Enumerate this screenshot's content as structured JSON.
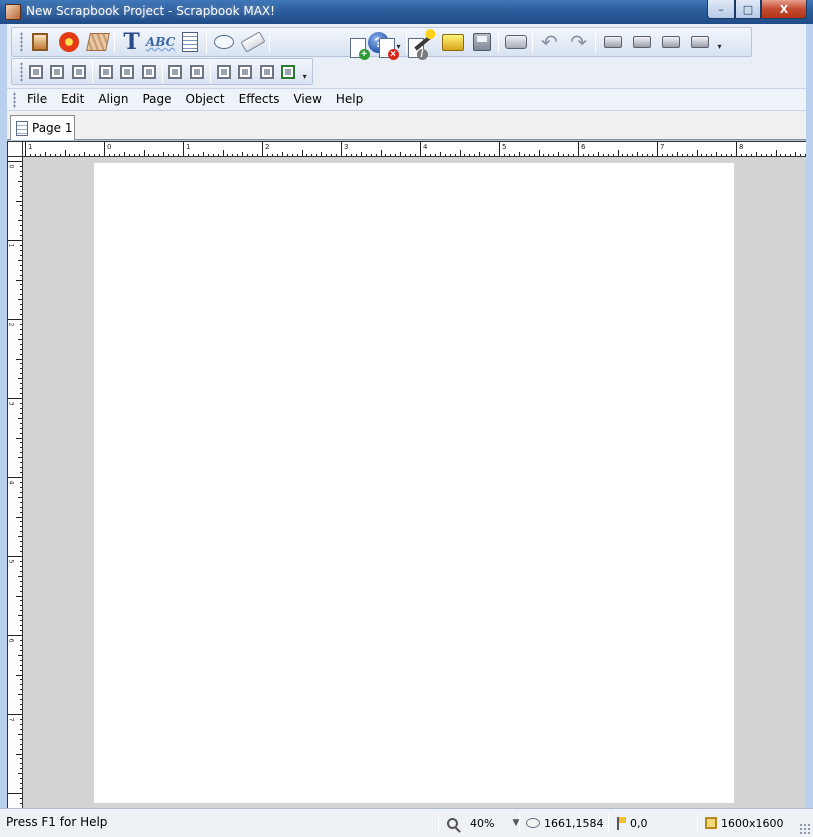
{
  "window": {
    "title": "New Scrapbook Project - Scrapbook MAX!",
    "buttons": {
      "minimize": "–",
      "maximize": "□",
      "close": "X"
    }
  },
  "toolbar1": {
    "buttons": [
      {
        "icon": "portrait-icon"
      },
      {
        "icon": "flower-icon"
      },
      {
        "icon": "paper-icon"
      },
      {
        "icon": "text-icon",
        "glyph": "T"
      },
      {
        "icon": "spellcheck-icon",
        "glyph": "ABC"
      },
      {
        "icon": "notepad-icon"
      },
      {
        "icon": "speech-balloon-icon"
      },
      {
        "icon": "eraser-icon"
      },
      {
        "icon": "new-page-icon"
      },
      {
        "icon": "delete-page-icon"
      },
      {
        "icon": "edit-page-icon"
      },
      {
        "icon": "help-icon",
        "glyph": "?"
      },
      {
        "icon": "magic-wand-icon"
      },
      {
        "icon": "open-folder-icon"
      },
      {
        "icon": "save-icon"
      },
      {
        "icon": "printer-icon"
      },
      {
        "icon": "undo-icon",
        "glyph": "↶"
      },
      {
        "icon": "redo-icon",
        "glyph": "↷"
      },
      {
        "icon": "bring-to-front-icon"
      },
      {
        "icon": "bring-forward-icon"
      },
      {
        "icon": "send-backward-icon"
      },
      {
        "icon": "send-to-back-icon"
      }
    ],
    "dropdown_glyph": "▾"
  },
  "toolbar2": {
    "buttons": [
      {
        "icon": "align-left-icon"
      },
      {
        "icon": "align-center-icon"
      },
      {
        "icon": "align-right-icon"
      },
      {
        "icon": "align-top-icon"
      },
      {
        "icon": "align-middle-icon"
      },
      {
        "icon": "align-bottom-icon"
      },
      {
        "icon": "space-horizontal-icon"
      },
      {
        "icon": "space-vertical-icon"
      },
      {
        "icon": "center-horizontal-icon"
      },
      {
        "icon": "center-vertical-icon"
      },
      {
        "icon": "center-page-icon"
      },
      {
        "icon": "green-export-icon"
      }
    ]
  },
  "menu": {
    "items": [
      "File",
      "Edit",
      "Align",
      "Page",
      "Object",
      "Effects",
      "View",
      "Help"
    ]
  },
  "tabs": [
    {
      "label": "Page 1",
      "active": true
    }
  ],
  "ruler": {
    "horizontal_labels": [
      "1",
      "0",
      "1",
      "2",
      "3",
      "4",
      "5",
      "6",
      "7",
      "8"
    ],
    "vertical_labels": [
      "0",
      "1",
      "2",
      "3",
      "4",
      "5",
      "6",
      "7"
    ]
  },
  "status": {
    "help_text": "Press F1 for Help",
    "zoom": "40%",
    "zoom_dropdown": "▼",
    "cursor_position": "1661,1584",
    "object_position": "0,0",
    "page_size": "1600x1600"
  },
  "colors": {
    "workspace": "#d3d3d3",
    "page": "#ffffff",
    "titlebar": "#2c5d9c"
  }
}
